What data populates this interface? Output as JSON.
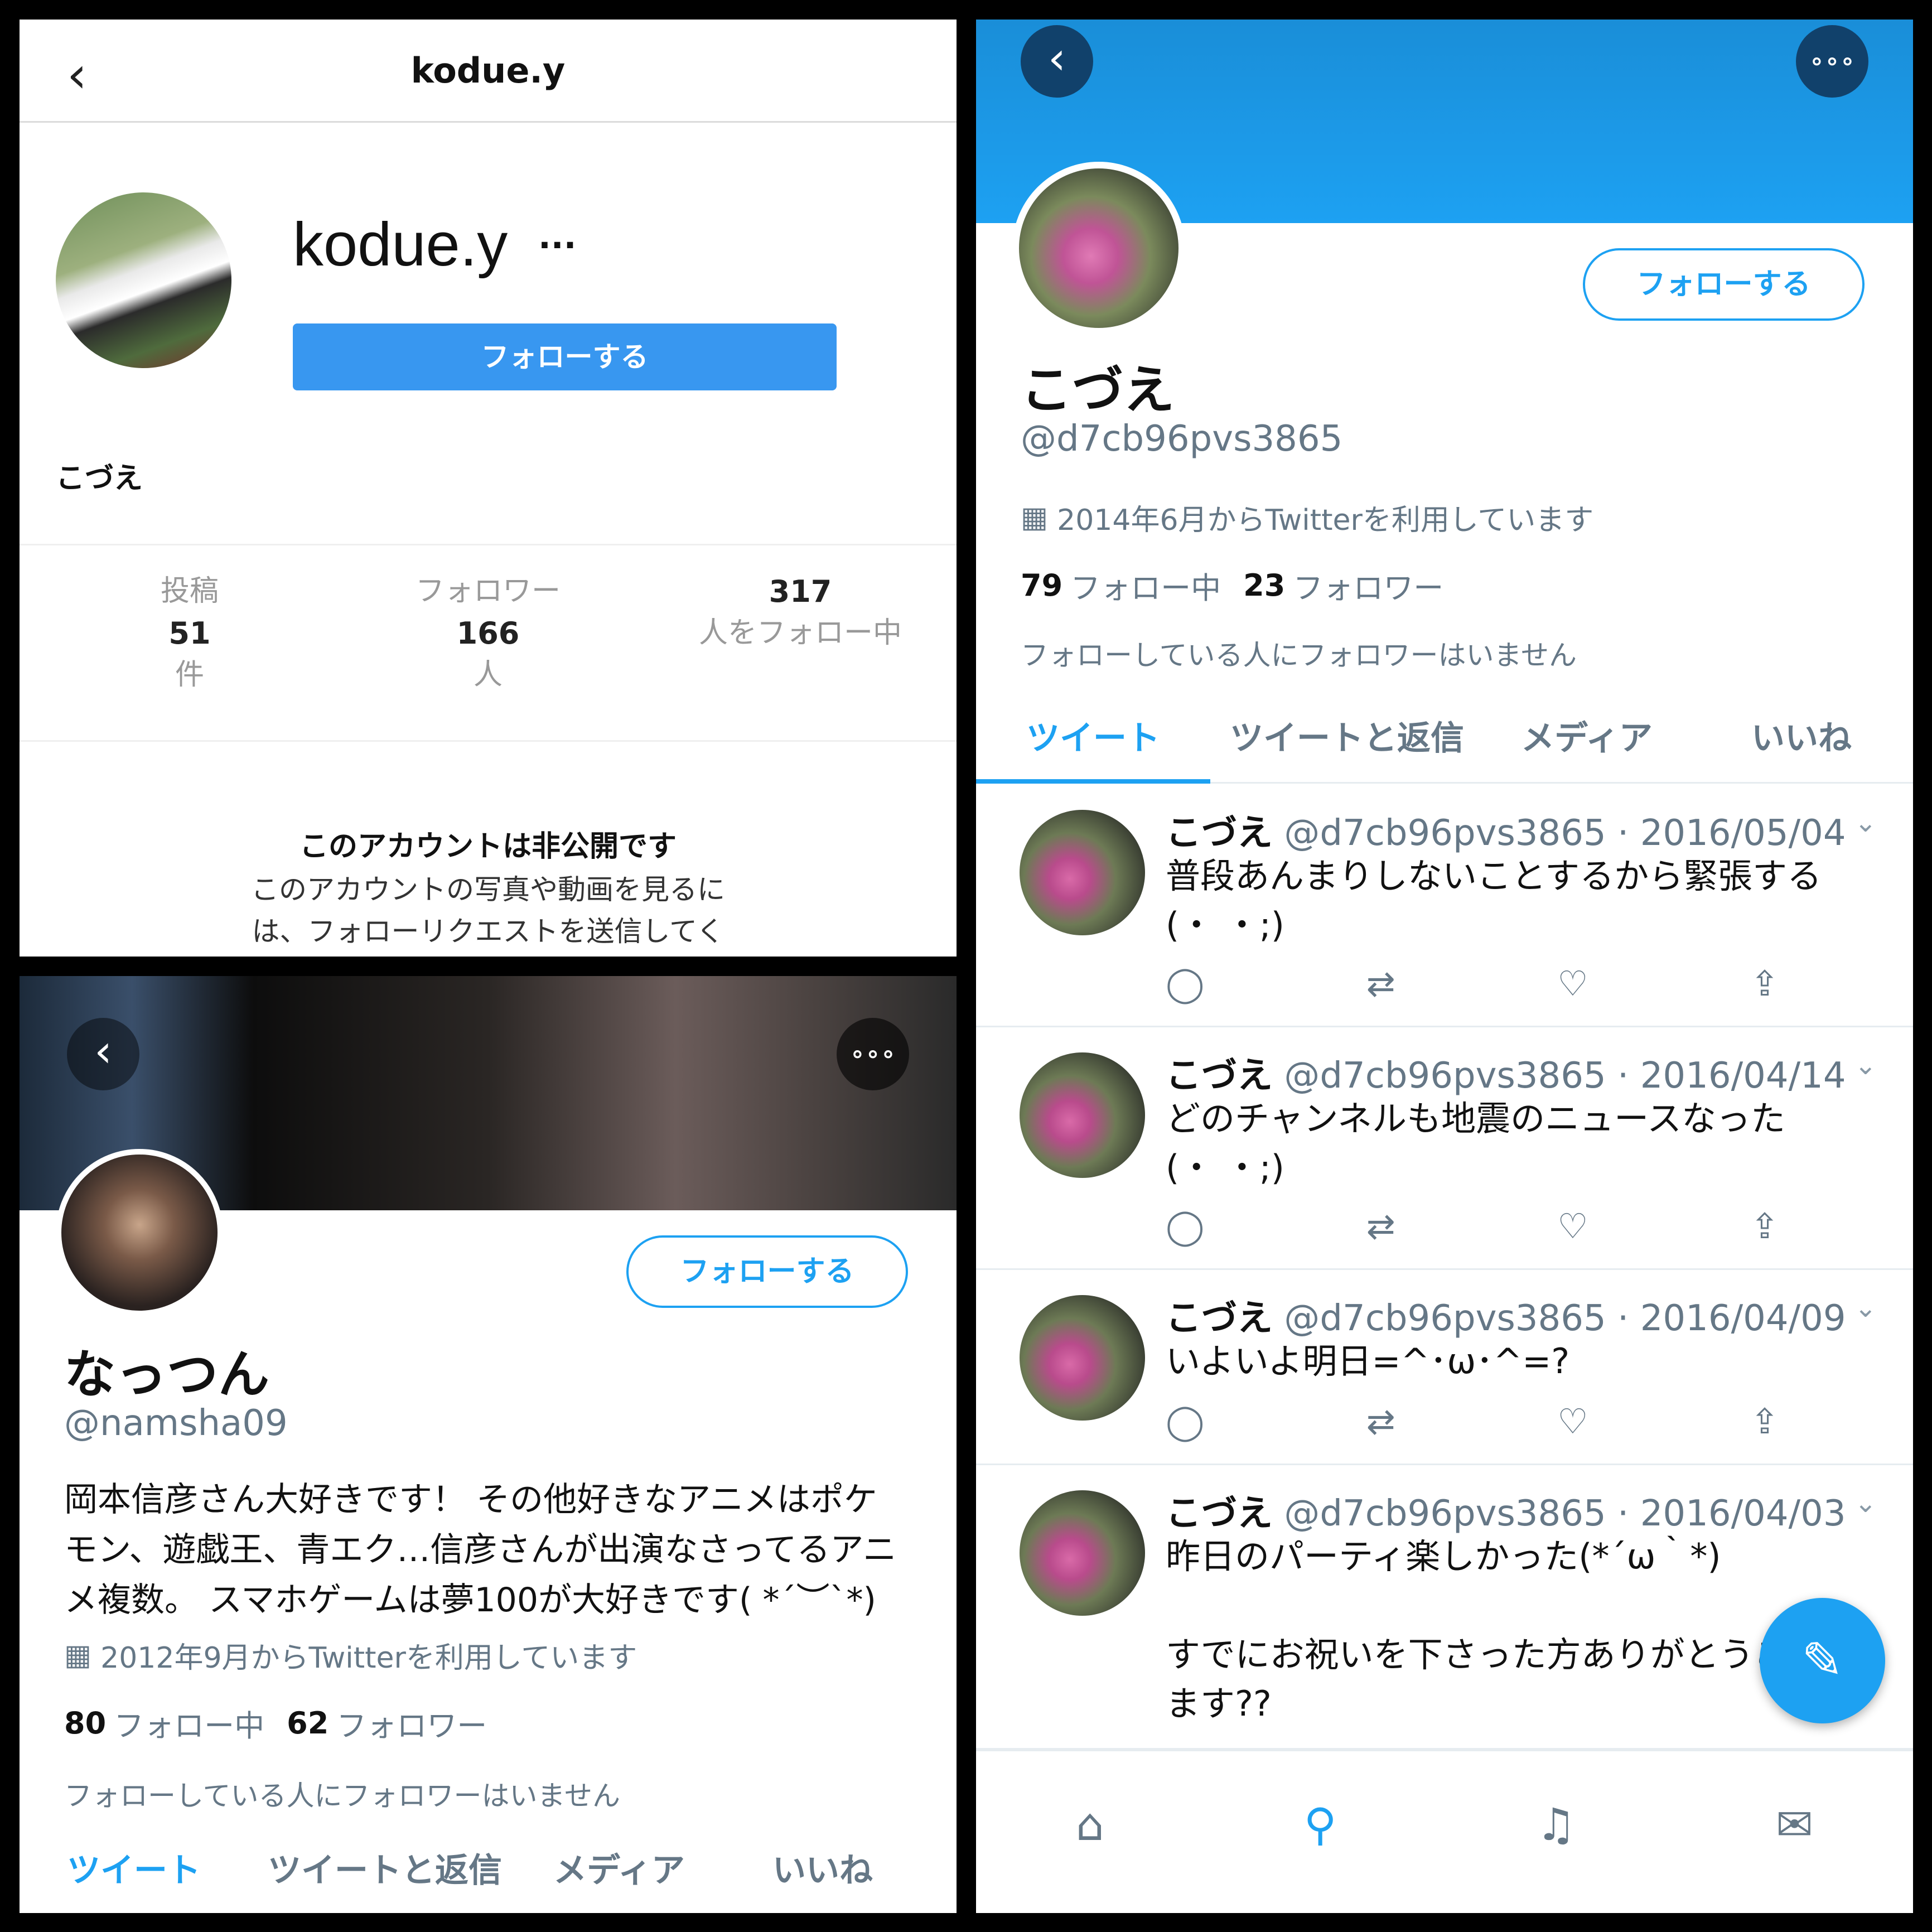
{
  "instagram": {
    "header_title": "kodue.y",
    "username": "kodue.y",
    "follow_label": "フォローする",
    "display_name": "こづえ",
    "stats": [
      {
        "label": "投稿",
        "value": "51",
        "unit": "件"
      },
      {
        "label": "フォロワー",
        "value": "166",
        "unit": "人"
      },
      {
        "label": "",
        "value": "317",
        "unit": "人をフォロー中"
      }
    ],
    "private_title": "このアカウントは非公開です",
    "private_line1": "このアカウントの写真や動画を見るに",
    "private_line2": "は、フォローリクエストを送信してく"
  },
  "twitter_left": {
    "follow_label": "フォローする",
    "name": "なっつん",
    "handle": "@namsha09",
    "bio_line1": "岡本信彦さん大好きです！ その他好きなアニメはポケ",
    "bio_line2": "モン、遊戯王、青エク…信彦さんが出演なさってるアニ",
    "bio_line3": "メ複数。 スマホゲームは夢100が大好きです( *´︶`*)",
    "joined": "2012年9月からTwitterを利用しています",
    "following_count": "80",
    "following_label": "フォロー中",
    "followers_count": "62",
    "followers_label": "フォロワー",
    "no_followers_note": "フォローしている人にフォロワーはいません",
    "tabs": [
      "ツイート",
      "ツイートと返信",
      "メディア",
      "いいね"
    ]
  },
  "twitter_right": {
    "follow_label": "フォローする",
    "name": "こづえ",
    "handle": "@d7cb96pvs3865",
    "joined": "2014年6月からTwitterを利用しています",
    "following_count": "79",
    "following_label": "フォロー中",
    "followers_count": "23",
    "followers_label": "フォロワー",
    "no_followers_note": "フォローしている人にフォロワーはいません",
    "tabs": [
      "ツイート",
      "ツイートと返信",
      "メディア",
      "いいね"
    ],
    "tweets": [
      {
        "name": "こづえ",
        "meta": "@d7cb96pvs3865 · 2016/05/04",
        "line1": "普段あんまりしないことするから緊張する",
        "line2": "(・ ・;)",
        "line3": "",
        "line4": ""
      },
      {
        "name": "こづえ",
        "meta": "@d7cb96pvs3865 · 2016/04/14",
        "line1": "どのチャンネルも地震のニュースなった",
        "line2": "(・ ・;)",
        "line3": "",
        "line4": ""
      },
      {
        "name": "こづえ",
        "meta": "@d7cb96pvs3865 · 2016/04/09",
        "line1": "いよいよ明日=^･ω･^=?",
        "line2": "",
        "line3": "",
        "line4": ""
      },
      {
        "name": "こづえ",
        "meta": "@d7cb96pvs3865 · 2016/04/03",
        "line1": "昨日のパーティ楽しかった(*´ω｀*)",
        "line2": "",
        "line3": "すでにお祝いを下さった方ありがとうご",
        "line4": "ます??"
      }
    ],
    "colors": {
      "accent": "#1da1f2",
      "header": "#1da1f2"
    }
  },
  "icons": [
    "back-icon",
    "more-icon",
    "calendar-icon",
    "reply-icon",
    "retweet-icon",
    "like-icon",
    "share-icon",
    "compose-icon",
    "home-icon",
    "search-icon",
    "bell-icon",
    "mail-icon"
  ]
}
